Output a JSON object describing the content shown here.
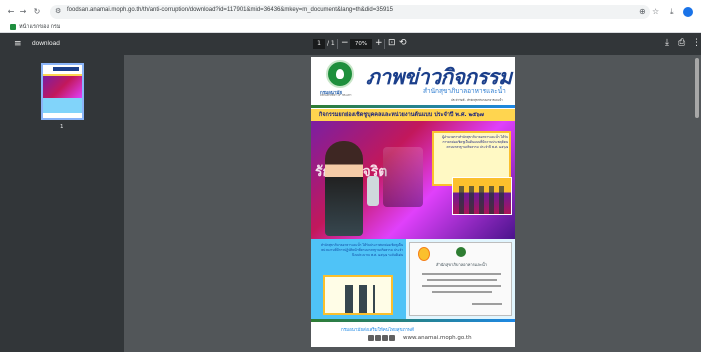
{
  "browser": {
    "url": "foodsan.anamai.moph.go.th/th/anti-corruption/download?id=117901&mid=36436&mkey=m_document&lang=th&did=35915",
    "bookmark": "หน้าแรกของ กรม",
    "colors": {
      "chrome_bg": "#ffffff",
      "accent": "#1a73e8"
    }
  },
  "pdf_toolbar": {
    "title": "download",
    "page_current": "1",
    "page_total": "/ 1",
    "zoom": "70%"
  },
  "sidebar": {
    "thumb_label": "1"
  },
  "document": {
    "dept_name": "กรมอนามัย",
    "dept_sub": "DEPARTMENT OF HEALTH",
    "title": "ภาพข่าวกิจกรรม",
    "subtitle": "สำนักสุขาภิบาลอาหารและน้ำ",
    "small_line": "ประจำวันที่ - สำนักสุขาภิบาลอาหารและน้ำ",
    "headline": "กิจกรรมยกย่องเชิดชูบุคคลและหน่วยงานต้นแบบ ประจำปี พ.ศ. ๒๕๖๗",
    "stage_text": "รักส  นสุจริต",
    "caption": "ผู้อำนวยการสำนักสุขาภิบาลอาหารและน้ำ ได้รับการยกย่องเชิดชูเป็นต้นแบบที่มีความประพฤติตนตามมาตรฐานจริยธรรม ประจำปี พ.ศ. ๒๕๖๗",
    "lower_caption": "สำนักสุขาภิบาลอาหารและน้ำ ได้รับประกาศยกย่องเชิดชูเป็นหน่วยงานที่มีการปฏิบัติหน้าที่ตามมาตรฐานจริยธรรม ประจำปีงบประมาณ พ.ศ. ๒๕๖๗ ระดับดีเด่น",
    "cert_title": "สำนักสุขาภิบาลอาหารและน้ำ",
    "footer_text": "กรมอนามัยส่งเสริมให้คนไทยสุขภาพดี",
    "footer_url": "www.anamai.moph.go.th"
  }
}
